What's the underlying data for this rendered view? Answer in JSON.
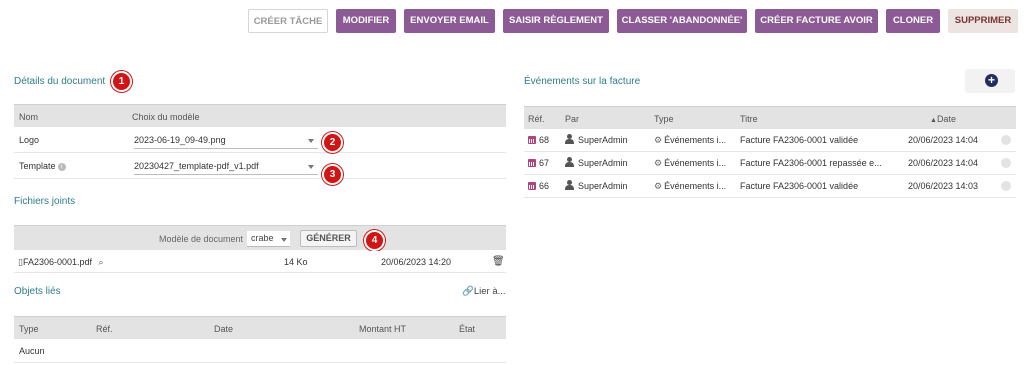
{
  "toolbar": {
    "create_task": "CRÉER TÂCHE",
    "modify": "MODIFIER",
    "send_email": "ENVOYER EMAIL",
    "enter_payment": "SAISIR RÈGLEMENT",
    "classify_abandoned": "CLASSER 'ABANDONNÉE'",
    "create_credit_note": "CRÉER FACTURE AVOIR",
    "clone": "CLONER",
    "delete": "SUPPRIMER"
  },
  "document": {
    "title": "Détails du document",
    "headers": {
      "name": "Nom",
      "model_choice": "Choix du modèle"
    },
    "rows": [
      {
        "name": "Logo",
        "value": "2023-06-19_09-49.png"
      },
      {
        "name": "Template",
        "value": "20230427_template-pdf_v1.pdf"
      }
    ]
  },
  "badges": [
    "1",
    "2",
    "3",
    "4"
  ],
  "attachments": {
    "title": "Fichiers joints",
    "model_label": "Modèle de document",
    "model_value": "crabe",
    "generate": "GÉNÉRER",
    "file": {
      "name": "FA2306-0001.pdf",
      "size": "14 Ko",
      "date": "20/06/2023 14:20"
    }
  },
  "linked": {
    "title": "Objets liés",
    "link_action": "Lier à...",
    "headers": {
      "type": "Type",
      "ref": "Réf.",
      "date": "Date",
      "amount": "Montant HT",
      "state": "État"
    },
    "empty": "Aucun"
  },
  "events": {
    "title": "Événements sur la facture",
    "headers": {
      "ref": "Réf.",
      "by": "Par",
      "type": "Type",
      "title": "Titre",
      "date": "Date"
    },
    "rows": [
      {
        "ref": "68",
        "by": "SuperAdmin",
        "type": "Événements i...",
        "title": "Facture FA2306-0001 validée",
        "date": "20/06/2023 14:04"
      },
      {
        "ref": "67",
        "by": "SuperAdmin",
        "type": "Événements i...",
        "title": "Facture FA2306-0001 repassée e...",
        "date": "20/06/2023 14:04"
      },
      {
        "ref": "66",
        "by": "SuperAdmin",
        "type": "Événements i...",
        "title": "Facture FA2306-0001 validée",
        "date": "20/06/2023 14:03"
      }
    ]
  },
  "colors": {
    "primary_button": "#8c5a94",
    "section_title": "#2f7d8a",
    "badge": "#d11414",
    "link": "#263c7f"
  }
}
